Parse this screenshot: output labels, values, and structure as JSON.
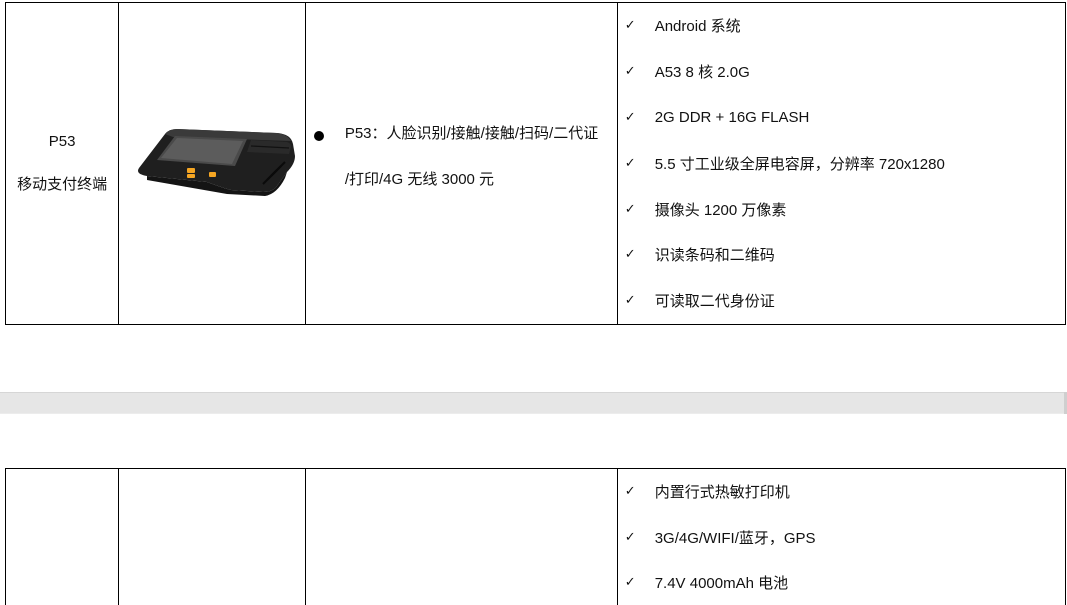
{
  "product": {
    "model": "P53",
    "type": "移动支付终端",
    "image_alt": "mobile-payment-terminal-photo",
    "description_line1": "P53：人脸识别/接触/接触/扫码/二代证",
    "description_line2": "/打印/4G 无线 3000 元",
    "features": [
      "Android 系统",
      "A53 8 核 2.0G",
      "2G DDR + 16G FLASH",
      "5.5 寸工业级全屏电容屏，分辨率 720x1280",
      "摄像头 1200 万像素",
      "识读条码和二维码",
      "可读取二代身份证"
    ]
  },
  "next_page": {
    "features": [
      "内置行式热敏打印机",
      "3G/4G/WIFI/蓝牙，GPS",
      "7.4V 4000mAh 电池"
    ]
  },
  "icons": {
    "check": "check-icon",
    "bullet": "bullet-icon"
  },
  "colors": {
    "border": "#000000",
    "page_gap": "#e6e6e6",
    "device_body": "#1e1e1e",
    "device_buttons": "#f5a623"
  }
}
